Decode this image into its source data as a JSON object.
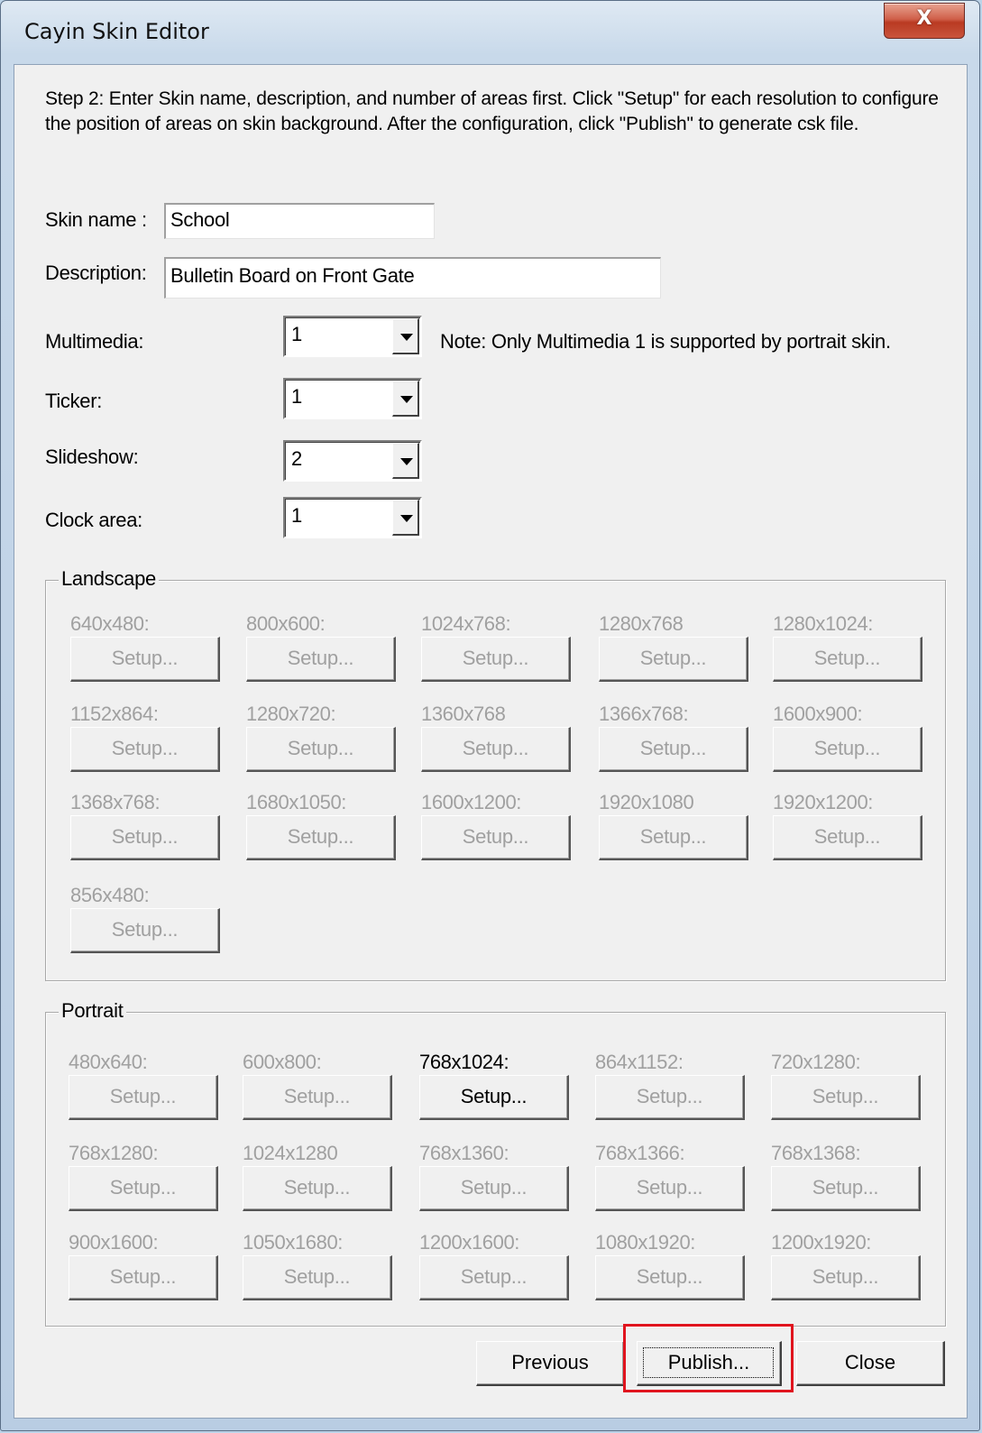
{
  "window": {
    "title": "Cayin Skin Editor",
    "close_glyph": "X"
  },
  "instructions": "Step 2: Enter Skin name, description, and number of areas first. Click \"Setup\" for each resolution to configure the position of areas on skin background. After the configuration, click \"Publish\" to generate csk file.",
  "form": {
    "skin_name_label": "Skin name :",
    "skin_name_value": "School",
    "description_label": "Description:",
    "description_value": "Bulletin Board on Front Gate",
    "multimedia_label": "Multimedia:",
    "multimedia_value": "1",
    "multimedia_note": "Note: Only Multimedia 1 is supported by portrait skin.",
    "ticker_label": "Ticker:",
    "ticker_value": "1",
    "slideshow_label": "Slideshow:",
    "slideshow_value": "2",
    "clock_label": "Clock area:",
    "clock_value": "1"
  },
  "landscape": {
    "title": "Landscape",
    "items": [
      {
        "label": "640x480:",
        "button": "Setup...",
        "enabled": false
      },
      {
        "label": "800x600:",
        "button": "Setup...",
        "enabled": false
      },
      {
        "label": "1024x768:",
        "button": "Setup...",
        "enabled": false
      },
      {
        "label": "1280x768",
        "button": "Setup...",
        "enabled": false
      },
      {
        "label": "1280x1024:",
        "button": "Setup...",
        "enabled": false
      },
      {
        "label": "1152x864:",
        "button": "Setup...",
        "enabled": false
      },
      {
        "label": "1280x720:",
        "button": "Setup...",
        "enabled": false
      },
      {
        "label": "1360x768",
        "button": "Setup...",
        "enabled": false
      },
      {
        "label": "1366x768:",
        "button": "Setup...",
        "enabled": false
      },
      {
        "label": "1600x900:",
        "button": "Setup...",
        "enabled": false
      },
      {
        "label": "1368x768:",
        "button": "Setup...",
        "enabled": false
      },
      {
        "label": "1680x1050:",
        "button": "Setup...",
        "enabled": false
      },
      {
        "label": "1600x1200:",
        "button": "Setup...",
        "enabled": false
      },
      {
        "label": "1920x1080",
        "button": "Setup...",
        "enabled": false
      },
      {
        "label": "1920x1200:",
        "button": "Setup...",
        "enabled": false
      },
      {
        "label": "856x480:",
        "button": "Setup...",
        "enabled": false
      }
    ]
  },
  "portrait": {
    "title": "Portrait",
    "items": [
      {
        "label": "480x640:",
        "button": "Setup...",
        "enabled": false
      },
      {
        "label": "600x800:",
        "button": "Setup...",
        "enabled": false
      },
      {
        "label": "768x1024:",
        "button": "Setup...",
        "enabled": true
      },
      {
        "label": "864x1152:",
        "button": "Setup...",
        "enabled": false
      },
      {
        "label": "720x1280:",
        "button": "Setup...",
        "enabled": false
      },
      {
        "label": "768x1280:",
        "button": "Setup...",
        "enabled": false
      },
      {
        "label": "1024x1280",
        "button": "Setup...",
        "enabled": false
      },
      {
        "label": "768x1360:",
        "button": "Setup...",
        "enabled": false
      },
      {
        "label": "768x1366:",
        "button": "Setup...",
        "enabled": false
      },
      {
        "label": "768x1368:",
        "button": "Setup...",
        "enabled": false
      },
      {
        "label": "900x1600:",
        "button": "Setup...",
        "enabled": false
      },
      {
        "label": "1050x1680:",
        "button": "Setup...",
        "enabled": false
      },
      {
        "label": "1200x1600:",
        "button": "Setup...",
        "enabled": false
      },
      {
        "label": "1080x1920:",
        "button": "Setup...",
        "enabled": false
      },
      {
        "label": "1200x1920:",
        "button": "Setup...",
        "enabled": false
      }
    ]
  },
  "footer": {
    "previous_label": "Previous",
    "publish_label": "Publish...",
    "close_label": "Close"
  },
  "colors": {
    "highlight": "#e0141e",
    "disabled_text": "#a0a0a0"
  }
}
